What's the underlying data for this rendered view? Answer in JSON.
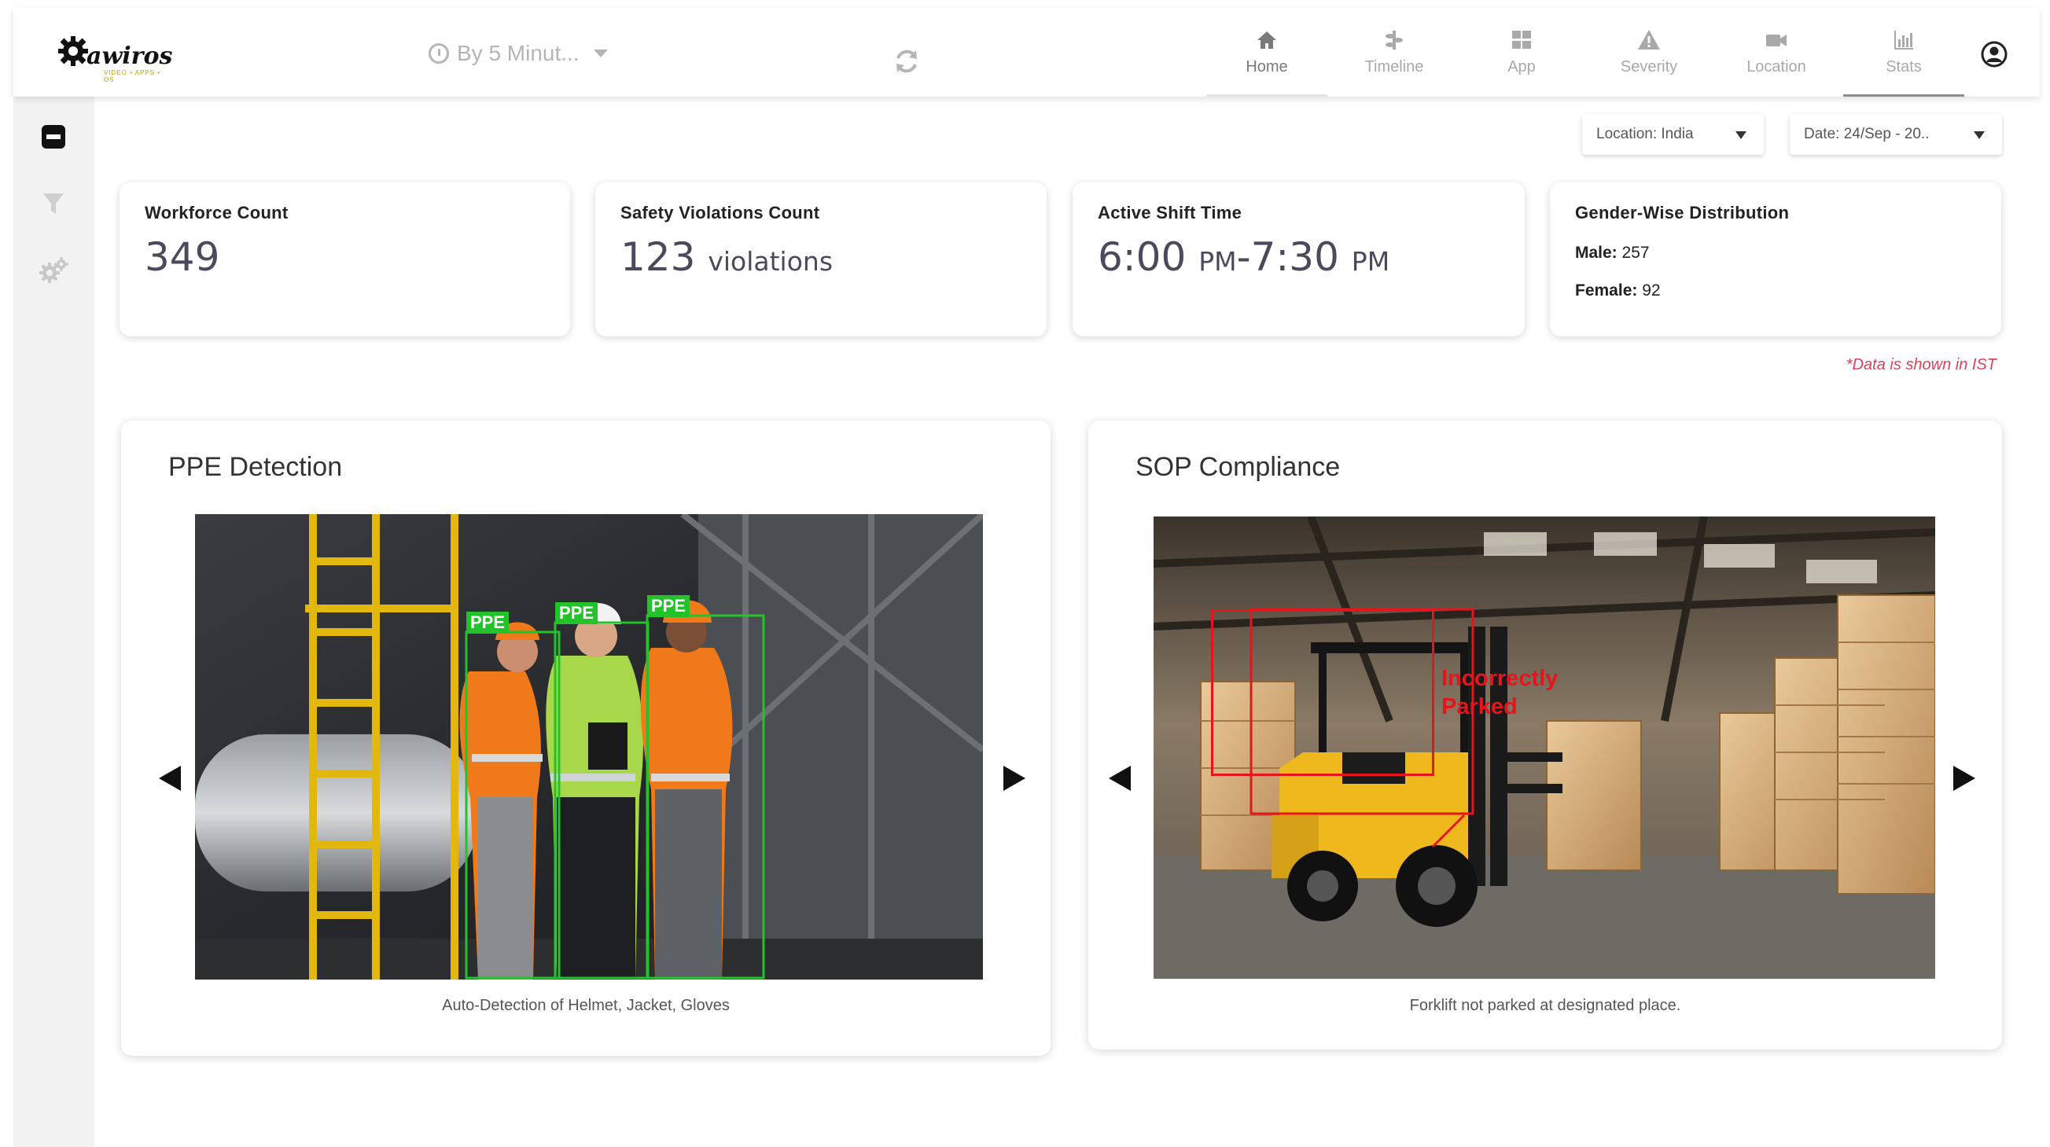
{
  "brand": {
    "name": "awiros",
    "tagline": "VIDEO • APPS • OS"
  },
  "toolbar": {
    "interval_label": "By 5 Minut..."
  },
  "nav": [
    {
      "label": "Home",
      "icon": "home-icon"
    },
    {
      "label": "Timeline",
      "icon": "timeline-icon"
    },
    {
      "label": "App",
      "icon": "app-grid-icon"
    },
    {
      "label": "Severity",
      "icon": "warning-icon"
    },
    {
      "label": "Location",
      "icon": "camera-icon"
    },
    {
      "label": "Stats",
      "icon": "bar-chart-icon"
    }
  ],
  "filters": {
    "location": "Location: India",
    "date": "Date: 24/Sep - 20.."
  },
  "cards": {
    "workforce": {
      "title": "Workforce Count",
      "value": "349"
    },
    "violations": {
      "title": "Safety Violations Count",
      "value": "123",
      "unit": "violations"
    },
    "shift": {
      "title": "Active Shift Time",
      "start": "6:00",
      "start_ampm": "PM",
      "separator": "-",
      "end": "7:30",
      "end_ampm": "PM"
    },
    "gender": {
      "title": "Gender-Wise Distribution",
      "male_label": "Male:",
      "male_value": "257",
      "female_label": "Female:",
      "female_value": "92"
    }
  },
  "note": "*Data is shown in IST",
  "panels": {
    "ppe": {
      "title": "PPE Detection",
      "caption": "Auto-Detection of Helmet, Jacket, Gloves",
      "box_label": "PPE"
    },
    "sop": {
      "title": "SOP Compliance",
      "caption": "Forklift not parked at designated place.",
      "alert_line1": "Incorrectly",
      "alert_line2": "Parked"
    }
  },
  "colors": {
    "detection_green": "#22c22a",
    "alert_red": "#e8141c",
    "note_red": "#d9435a",
    "nav_gray": "#a9a9a9"
  }
}
